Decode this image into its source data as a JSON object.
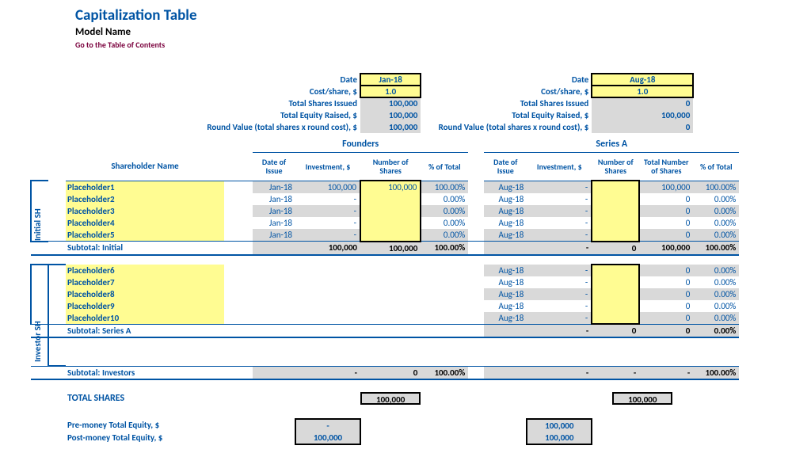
{
  "header": {
    "title": "Capitalization Table",
    "subtitle": "Model Name",
    "toc_link": "Go to the Table of Contents"
  },
  "summary_labels": {
    "date": "Date",
    "cost": "Cost/share, $",
    "shares_issued": "Total Shares Issued",
    "equity_raised": "Total Equity Raised, $",
    "round_value": "Round Value (total shares x round cost), $"
  },
  "founders_summary": {
    "date": "Jan-18",
    "cost": "1.0",
    "shares": "100,000",
    "equity": "100,000",
    "round": "100,000"
  },
  "seriesA_summary": {
    "date": "Aug-18",
    "cost": "1.0",
    "shares": "0",
    "equity": "100,000",
    "round": "0"
  },
  "sections": {
    "founders": "Founders",
    "seriesA": "Series A"
  },
  "column_headers": {
    "shareholder": "Shareholder Name",
    "date": "Date of Issue",
    "investment": "Investment, $",
    "num_shares": "Number of Shares",
    "pct": "% of Total",
    "total_shares": "Total Number of Shares"
  },
  "side_labels": {
    "initial": "Initial SH",
    "investor": "Investor SH"
  },
  "initial": [
    {
      "name": "Placeholder1",
      "f_date": "Jan-18",
      "f_inv": "100,000",
      "f_sh": "100,000",
      "f_pct": "100.00%",
      "a_date": "Aug-18",
      "a_inv": "-",
      "a_sh": "",
      "a_tot": "100,000",
      "a_pct": "100.00%"
    },
    {
      "name": "Placeholder2",
      "f_date": "Jan-18",
      "f_inv": "-",
      "f_sh": "",
      "f_pct": "0.00%",
      "a_date": "Aug-18",
      "a_inv": "-",
      "a_sh": "",
      "a_tot": "0",
      "a_pct": "0.00%"
    },
    {
      "name": "Placeholder3",
      "f_date": "Jan-18",
      "f_inv": "-",
      "f_sh": "",
      "f_pct": "0.00%",
      "a_date": "Aug-18",
      "a_inv": "-",
      "a_sh": "",
      "a_tot": "0",
      "a_pct": "0.00%"
    },
    {
      "name": "Placeholder4",
      "f_date": "Jan-18",
      "f_inv": "-",
      "f_sh": "",
      "f_pct": "0.00%",
      "a_date": "Aug-18",
      "a_inv": "-",
      "a_sh": "",
      "a_tot": "0",
      "a_pct": "0.00%"
    },
    {
      "name": "Placeholder5",
      "f_date": "Jan-18",
      "f_inv": "-",
      "f_sh": "",
      "f_pct": "0.00%",
      "a_date": "Aug-18",
      "a_inv": "-",
      "a_sh": "",
      "a_tot": "0",
      "a_pct": "0.00%"
    }
  ],
  "subtotal_initial": {
    "label": "Subtotal: Initial",
    "f_inv": "100,000",
    "f_sh": "100,000",
    "f_pct": "100.00%",
    "a_inv": "-",
    "a_sh": "0",
    "a_tot": "100,000",
    "a_pct": "100.00%"
  },
  "investors": [
    {
      "name": "Placeholder6",
      "a_date": "Aug-18",
      "a_inv": "-",
      "a_sh": "",
      "a_tot": "0",
      "a_pct": "0.00%"
    },
    {
      "name": "Placeholder7",
      "a_date": "Aug-18",
      "a_inv": "-",
      "a_sh": "",
      "a_tot": "0",
      "a_pct": "0.00%"
    },
    {
      "name": "Placeholder8",
      "a_date": "Aug-18",
      "a_inv": "-",
      "a_sh": "",
      "a_tot": "0",
      "a_pct": "0.00%"
    },
    {
      "name": "Placeholder9",
      "a_date": "Aug-18",
      "a_inv": "-",
      "a_sh": "",
      "a_tot": "0",
      "a_pct": "0.00%"
    },
    {
      "name": "Placeholder10",
      "a_date": "Aug-18",
      "a_inv": "-",
      "a_sh": "",
      "a_tot": "0",
      "a_pct": "0.00%"
    }
  ],
  "subtotal_seriesA": {
    "label": "Subtotal: Series A",
    "a_inv": "-",
    "a_sh": "0",
    "a_tot": "0",
    "a_pct": "0.00%"
  },
  "subtotal_investors": {
    "label": "Subtotal: Investors",
    "f_inv": "-",
    "f_sh": "0",
    "f_pct": "100.00%",
    "a_inv": "-",
    "a_sh": "-",
    "a_tot": "-",
    "a_pct": "100.00%"
  },
  "totals": {
    "label_shares": "TOTAL SHARES",
    "f_shares": "100,000",
    "a_shares": "100,000",
    "label_pre": "Pre-money Total Equity, $",
    "f_pre": "-",
    "a_pre": "100,000",
    "label_post": "Post-money Total Equity, $",
    "f_post": "100,000",
    "a_post": "100,000"
  }
}
